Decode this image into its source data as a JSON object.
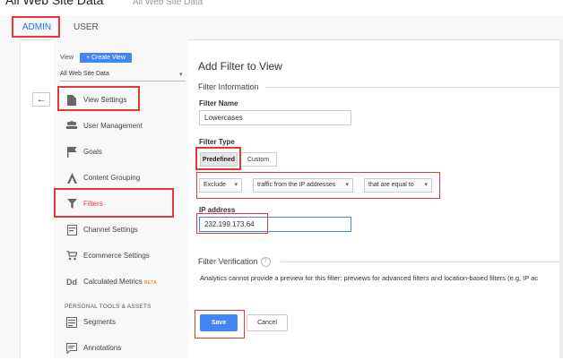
{
  "header": {
    "title": "All Web Site Data",
    "crumb": "All Web Site Data"
  },
  "tabs": [
    {
      "label": "ADMIN"
    },
    {
      "label": "USER"
    }
  ],
  "sidebar": {
    "view_label": "View",
    "create_view_label": "+ Create View",
    "view_select": "All Web Site Data",
    "items": [
      {
        "label": "View Settings",
        "icon": "document-icon"
      },
      {
        "label": "User Management",
        "icon": "users-icon"
      },
      {
        "label": "Goals",
        "icon": "flag-icon"
      },
      {
        "label": "Content Grouping",
        "icon": "grouping-icon"
      },
      {
        "label": "Filters",
        "icon": "filter-icon"
      },
      {
        "label": "Channel Settings",
        "icon": "channel-icon"
      },
      {
        "label": "Ecommerce Settings",
        "icon": "cart-icon"
      },
      {
        "label": "Calculated Metrics",
        "icon": "dd-icon",
        "badge": "BETA"
      },
      {
        "label": "Segments",
        "icon": "segments-icon"
      },
      {
        "label": "Annotations",
        "icon": "annotation-icon"
      }
    ],
    "section_header": "PERSONAL TOOLS & ASSETS"
  },
  "form": {
    "page_title": "Add Filter to View",
    "section_info": "Filter Information",
    "name_label": "Filter Name",
    "name_value": "Lowercases",
    "type_label": "Filter Type",
    "type_predefined": "Predefined",
    "type_custom": "Custom",
    "dd_exclude": "Exclude",
    "dd_source": "traffic from the IP addresses",
    "dd_expression": "that are equal to",
    "ip_label": "IP address",
    "ip_value": "232.199.173.64",
    "verification_title": "Filter Verification",
    "verification_text": "Analytics cannot provide a preview for this filter: previews for advanced filters and location-based filters (e.g, IP ac",
    "save_label": "Save",
    "cancel_label": "Cancel"
  },
  "colors": {
    "accent": "#4285f4",
    "highlight": "#e53935"
  }
}
